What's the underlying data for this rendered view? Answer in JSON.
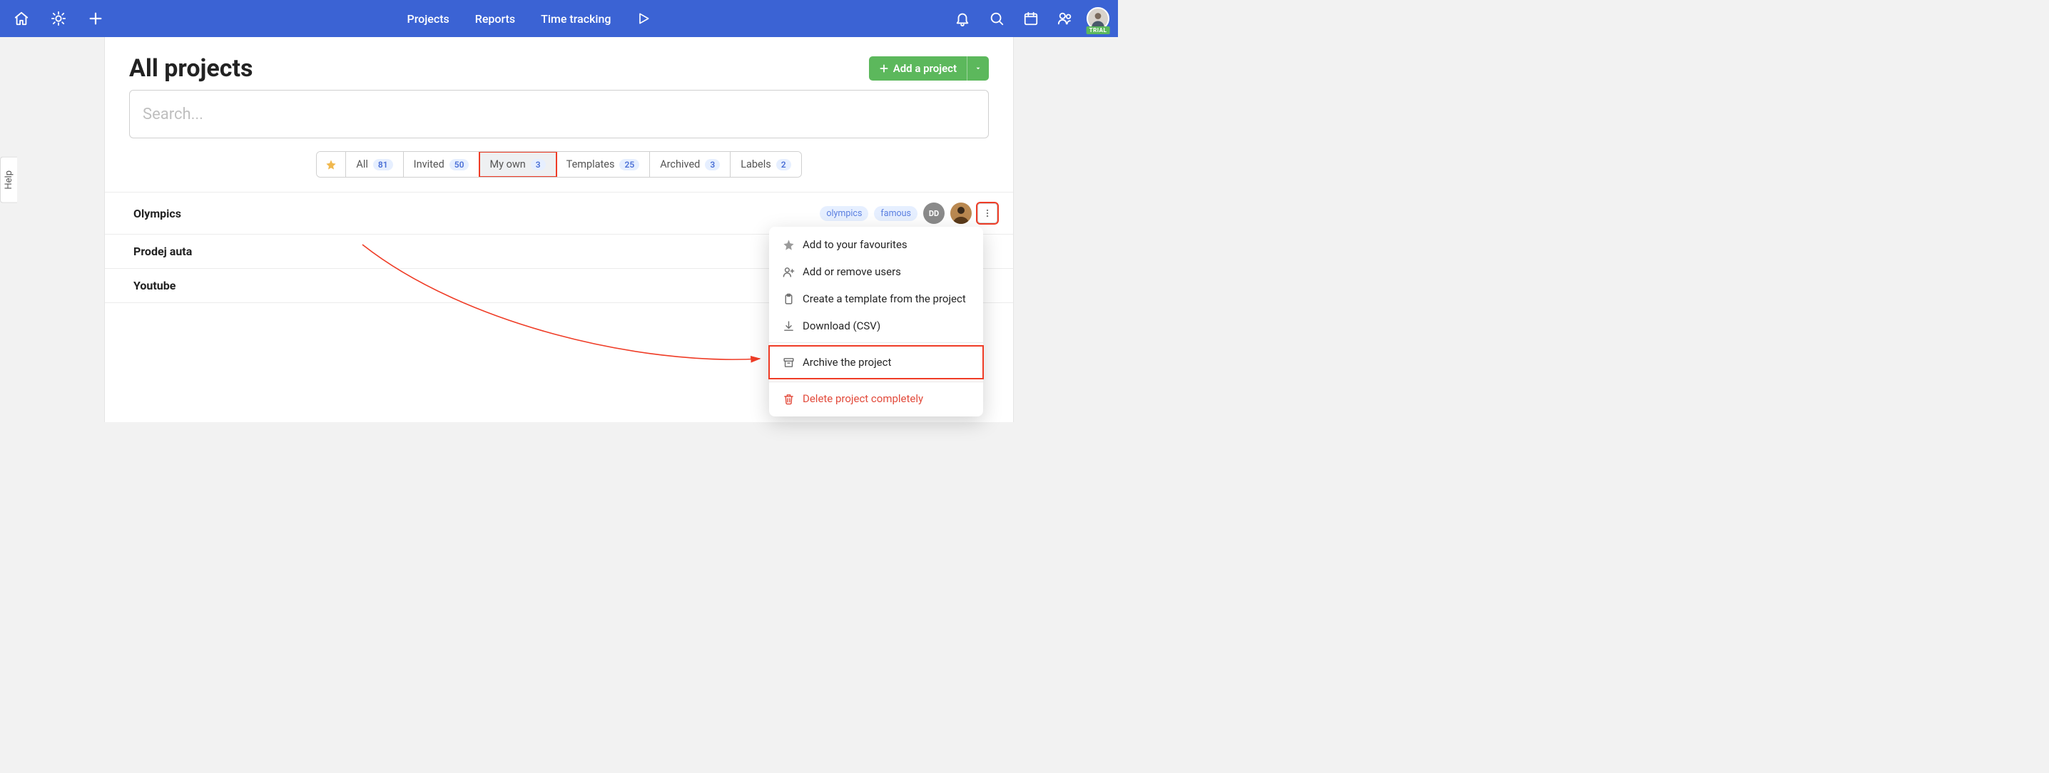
{
  "nav": {
    "projects": "Projects",
    "reports": "Reports",
    "time_tracking": "Time tracking",
    "trial_badge": "TRIAL"
  },
  "help_tab": "Help",
  "page": {
    "title": "All projects",
    "add_project": "Add a project",
    "search_placeholder": "Search..."
  },
  "filters": {
    "all": {
      "label": "All",
      "count": "81"
    },
    "invited": {
      "label": "Invited",
      "count": "50"
    },
    "my_own": {
      "label": "My own",
      "count": "3"
    },
    "templates": {
      "label": "Templates",
      "count": "25"
    },
    "archived": {
      "label": "Archived",
      "count": "3"
    },
    "labels": {
      "label": "Labels",
      "count": "2"
    }
  },
  "projects": [
    {
      "name": "Olympics",
      "tags": [
        "olympics",
        "famous"
      ],
      "avatars": [
        {
          "type": "initials",
          "text": "DD"
        },
        {
          "type": "image"
        }
      ]
    },
    {
      "name": "Prodej auta",
      "tags": [],
      "avatars": []
    },
    {
      "name": "Youtube",
      "tags": [],
      "avatars": []
    }
  ],
  "menu": {
    "favourite": "Add to your favourites",
    "users": "Add or remove users",
    "template": "Create a template from the project",
    "download": "Download (CSV)",
    "archive": "Archive the project",
    "delete": "Delete project completely"
  }
}
